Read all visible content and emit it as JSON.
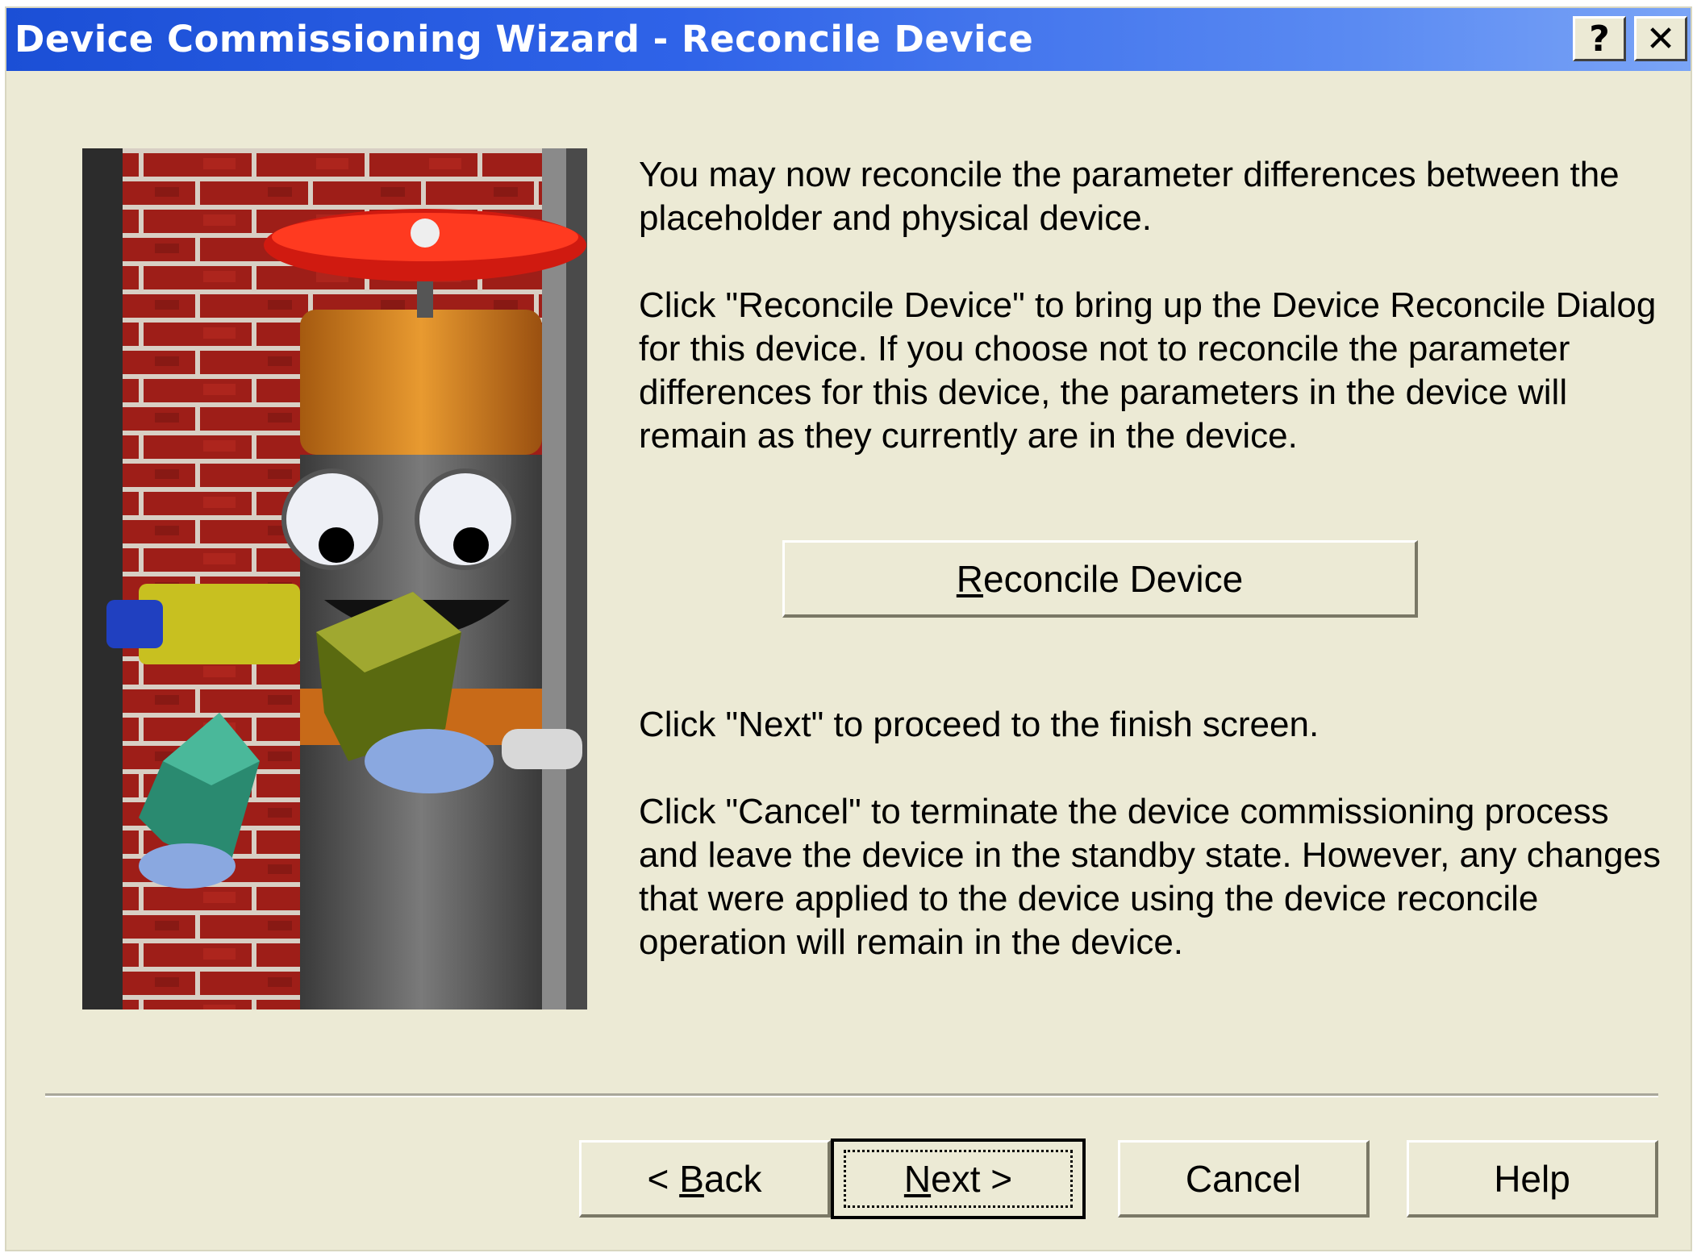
{
  "window": {
    "title": "Device Commissioning Wizard - Reconcile Device",
    "help_glyph": "?",
    "close_glyph": "✕"
  },
  "illustration": {
    "icon": "valve-mascot-illustration"
  },
  "content": {
    "paragraph1": "You may now reconcile the parameter differences between the placeholder and physical device.",
    "paragraph2": "Click \"Reconcile Device\" to bring up the Device Reconcile Dialog for this device. If you choose not to reconcile the parameter differences for this device, the parameters in the device will remain as they currently are in the device.",
    "paragraph3": "Click \"Next\" to proceed to the finish screen.",
    "paragraph4": "Click \"Cancel\" to terminate the device commissioning process and leave the device in the standby state. However, any changes that were applied to the device using the device reconcile operation will remain in the device."
  },
  "buttons": {
    "reconcile": {
      "mnemonic": "R",
      "rest": "econcile Device"
    },
    "back": {
      "prefix": "< ",
      "mnemonic": "B",
      "rest": "ack"
    },
    "next": {
      "mnemonic": "N",
      "rest": "ext >"
    },
    "cancel": "Cancel",
    "help": "Help"
  },
  "colors": {
    "titlebar_start": "#1b4fd6",
    "titlebar_end": "#7aa4f6",
    "dialog_bg": "#ecead5"
  }
}
